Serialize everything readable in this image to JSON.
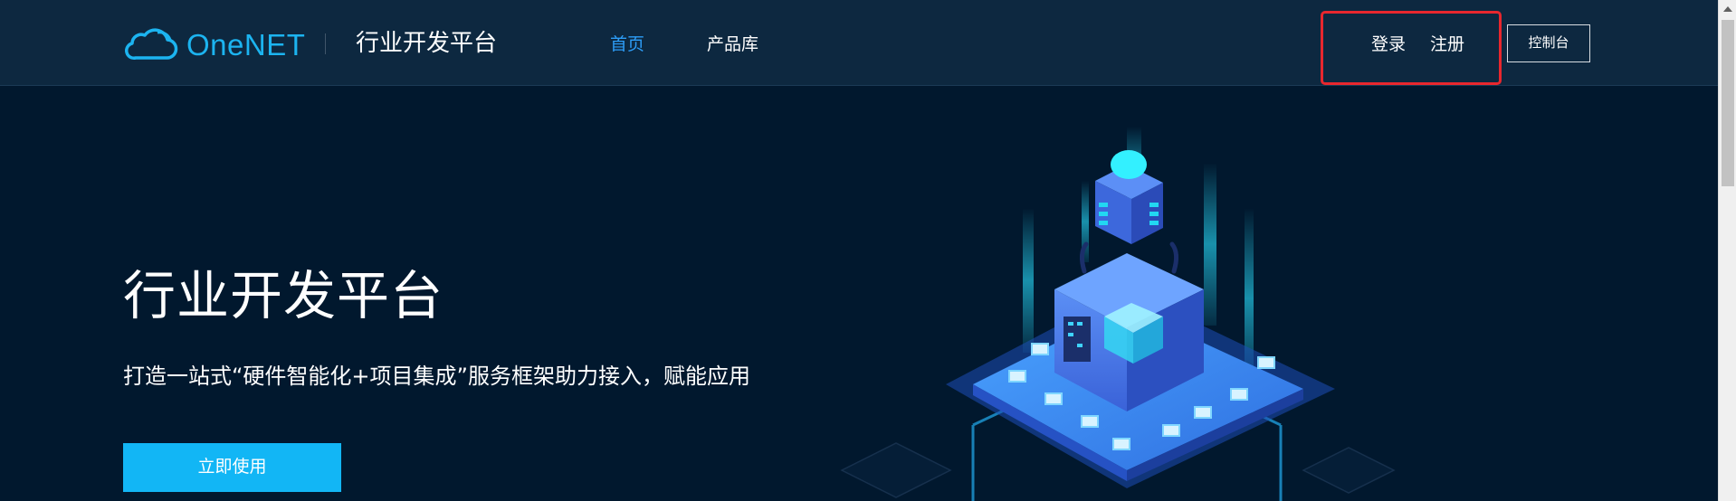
{
  "header": {
    "logo_text": "OneNET",
    "platform_title": "行业开发平台",
    "nav": [
      {
        "label": "首页",
        "active": true
      },
      {
        "label": "产品库",
        "active": false
      }
    ],
    "login_label": "登录",
    "register_label": "注册",
    "console_label": "控制台"
  },
  "hero": {
    "title": "行业开发平台",
    "subtitle": "打造一站式“硬件智能化+项目集成”服务框架助力接入，赋能应用",
    "cta_label": "立即使用"
  },
  "colors": {
    "page_bg": "#01182e",
    "header_bg": "#0d2840",
    "brand": "#1cb4f0",
    "nav_active": "#2d9df7",
    "cta": "#12b6f5",
    "highlight_box": "#e8272e"
  },
  "icons": {
    "logo": "cloud-icon"
  }
}
